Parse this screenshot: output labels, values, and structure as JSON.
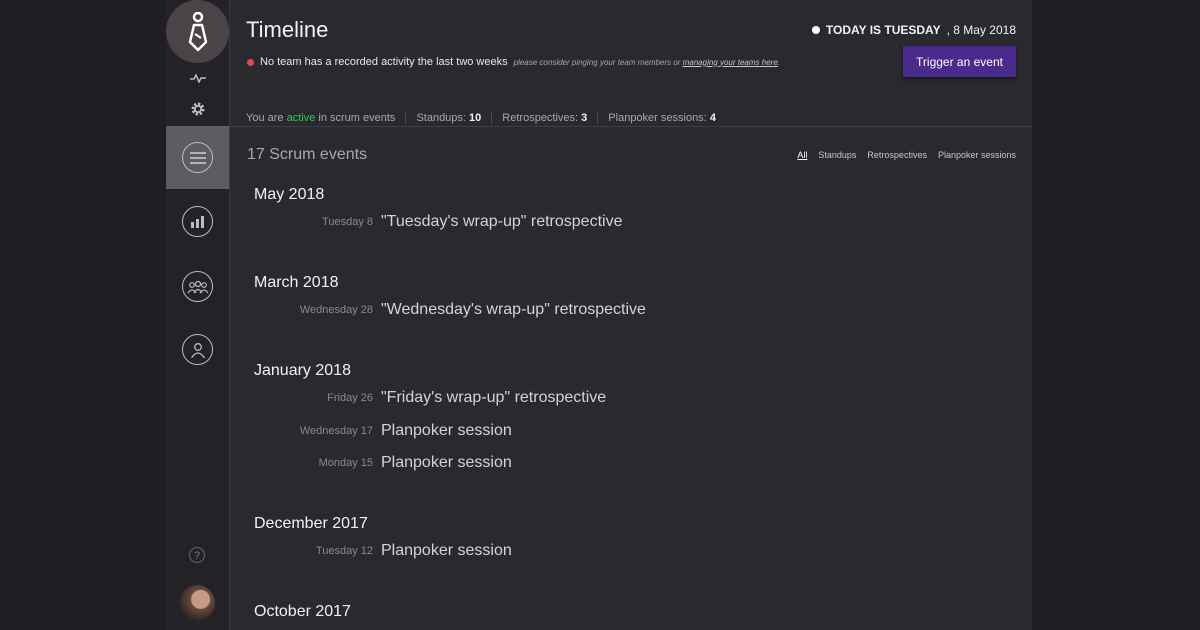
{
  "header": {
    "title": "Timeline",
    "today_label": "TODAY IS TUESDAY",
    "today_date": ", 8 May 2018"
  },
  "alert": {
    "text": "No team has a recorded activity the last two weeks",
    "hint": "please consider pinging your team members or",
    "link": "managing your teams here",
    "hint_end": "."
  },
  "trigger_button": "Trigger an event",
  "stats": {
    "prefix": "You are",
    "status": "active",
    "suffix": "in scrum events",
    "standups_label": "Standups:",
    "standups": "10",
    "retros_label": "Retrospectives:",
    "retros": "3",
    "planpoker_label": "Planpoker sessions:",
    "planpoker": "4"
  },
  "events_count": "17 Scrum events",
  "filters": [
    "All",
    "Standups",
    "Retrospectives",
    "Planpoker sessions"
  ],
  "months": [
    {
      "label": "May 2018",
      "events": [
        {
          "date": "Tuesday 8",
          "title": "\"Tuesday's wrap-up\" retrospective"
        }
      ]
    },
    {
      "label": "March 2018",
      "events": [
        {
          "date": "Wednesday 28",
          "title": "\"Wednesday's wrap-up\" retrospective"
        }
      ]
    },
    {
      "label": "January 2018",
      "events": [
        {
          "date": "Friday 26",
          "title": "\"Friday's wrap-up\" retrospective"
        },
        {
          "date": "Wednesday 17",
          "title": "Planpoker session"
        },
        {
          "date": "Monday 15",
          "title": "Planpoker session"
        }
      ]
    },
    {
      "label": "December 2017",
      "events": [
        {
          "date": "Tuesday 12",
          "title": "Planpoker session"
        }
      ]
    },
    {
      "label": "October 2017",
      "events": []
    }
  ],
  "sidebar": {
    "icons": [
      "tie-logo-icon",
      "activity-icon",
      "gear-icon",
      "menu-icon",
      "chart-icon",
      "team-icon",
      "user-icon"
    ],
    "help": "?"
  },
  "colors": {
    "accent": "#4a2a8c",
    "active": "#33c55a",
    "alert": "#e5484d"
  }
}
